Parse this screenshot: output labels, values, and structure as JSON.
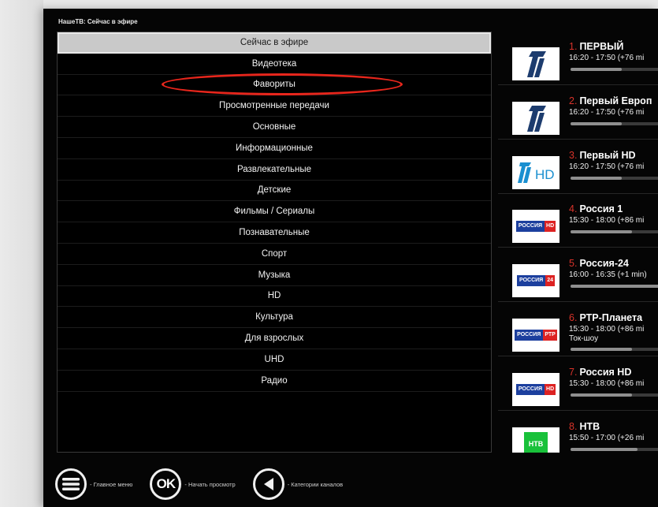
{
  "header": {
    "title": "НашеТВ: Сейчас в эфире"
  },
  "categories": [
    {
      "label": "Сейчас в эфире",
      "selected": true
    },
    {
      "label": "Видеотека"
    },
    {
      "label": "Фавориты",
      "highlighted": true
    },
    {
      "label": "Просмотренные передачи"
    },
    {
      "label": "Основные"
    },
    {
      "label": "Информационные"
    },
    {
      "label": "Развлекательные"
    },
    {
      "label": "Детские"
    },
    {
      "label": "Фильмы / Сериалы"
    },
    {
      "label": "Познавательные"
    },
    {
      "label": "Спорт"
    },
    {
      "label": "Музыка"
    },
    {
      "label": "HD"
    },
    {
      "label": "Культура"
    },
    {
      "label": "Для взрослых"
    },
    {
      "label": "UHD"
    },
    {
      "label": "Радио"
    }
  ],
  "channels": [
    {
      "num": "1.",
      "name": "ПЕРВЫЙ",
      "time": "16:20 - 17:50 (+76 mi",
      "progress": 0.5,
      "logo": "pervyi"
    },
    {
      "num": "2.",
      "name": "Первый Европ",
      "time": "16:20 - 17:50 (+76 mi",
      "progress": 0.5,
      "logo": "pervyi"
    },
    {
      "num": "3.",
      "name": "Первый HD",
      "time": "16:20 - 17:50 (+76 mi",
      "progress": 0.5,
      "logo": "pervyi-hd"
    },
    {
      "num": "4.",
      "name": "Россия 1",
      "time": "15:30 - 18:00 (+86 mi",
      "progress": 0.6,
      "logo": "rossiya",
      "logo_tag": "HD"
    },
    {
      "num": "5.",
      "name": "Россия-24",
      "time": "16:00 - 16:35 (+1 min)",
      "progress": 0.95,
      "logo": "rossiya",
      "logo_tag": "24"
    },
    {
      "num": "6.",
      "name": "РТР-Планета",
      "time": "15:30 - 18:00 (+86 mi",
      "extra": "Ток-шоу",
      "progress": 0.6,
      "logo": "rossiya",
      "logo_tag": "РТР"
    },
    {
      "num": "7.",
      "name": "Россия HD",
      "time": "15:30 - 18:00 (+86 mi",
      "progress": 0.6,
      "logo": "rossiya",
      "logo_tag": "HD"
    },
    {
      "num": "8.",
      "name": "НТВ",
      "time": "15:50 - 17:00 (+26 mi",
      "progress": 0.65,
      "logo": "ntv"
    }
  ],
  "footer": {
    "menu_label": "- Главное меню",
    "ok_label": "- Начать просмотр",
    "ok_icon_text": "OK",
    "back_label": "- Категории каналов"
  },
  "colors": {
    "highlight": "#e8261c",
    "channel_number": "#d8332a",
    "logo_blue": "#1c3f9e",
    "logo_green": "#19c13a"
  },
  "logos": {
    "rossiya": "РОССИЯ",
    "ntv": "НТВ",
    "hd": "HD"
  }
}
